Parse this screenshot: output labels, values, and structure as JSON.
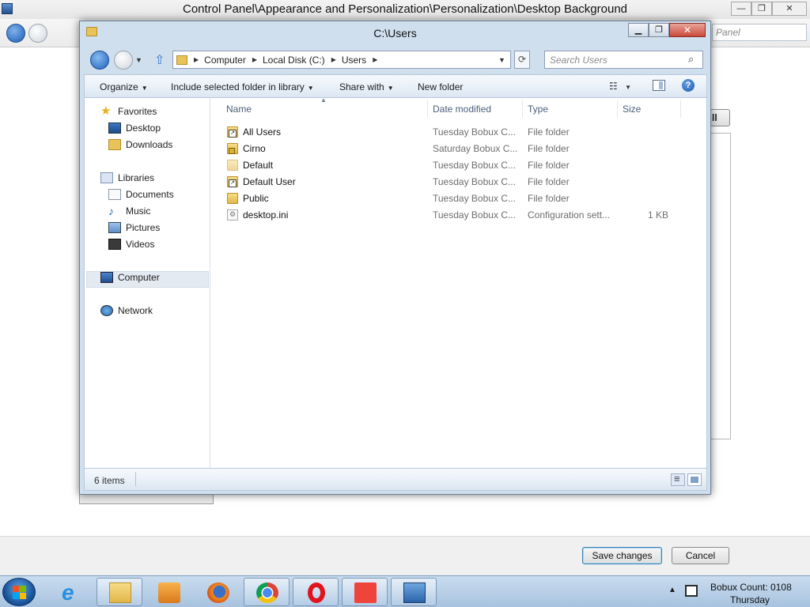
{
  "background_window": {
    "title": "Control Panel\\Appearance and Personalization\\Personalization\\Desktop Background",
    "search_placeholder": "Panel",
    "side_button_label": "ll",
    "save_label": "Save changes",
    "cancel_label": "Cancel",
    "controls": {
      "minimize": "—",
      "maximize": "❐",
      "close": "✕"
    }
  },
  "explorer": {
    "title": "C:\\Users",
    "controls": {
      "minimize": "▁",
      "maximize": "❐",
      "close": "✕"
    },
    "breadcrumb": [
      "Computer",
      "Local Disk (C:)",
      "Users"
    ],
    "search_placeholder": "Search Users",
    "toolbar": {
      "organize": "Organize",
      "include": "Include selected folder in library",
      "share": "Share with",
      "new_folder": "New folder"
    },
    "nav": {
      "favorites": "Favorites",
      "desktop": "Desktop",
      "downloads": "Downloads",
      "libraries": "Libraries",
      "documents": "Documents",
      "music": "Music",
      "pictures": "Pictures",
      "videos": "Videos",
      "computer": "Computer",
      "network": "Network"
    },
    "columns": {
      "name": "Name",
      "date": "Date modified",
      "type": "Type",
      "size": "Size"
    },
    "files": [
      {
        "name": "All Users",
        "date": "Tuesday Bobux C...",
        "type": "File folder",
        "size": ""
      },
      {
        "name": "Cirno",
        "date": "Saturday Bobux C...",
        "type": "File folder",
        "size": ""
      },
      {
        "name": "Default",
        "date": "Tuesday Bobux C...",
        "type": "File folder",
        "size": ""
      },
      {
        "name": "Default User",
        "date": "Tuesday Bobux C...",
        "type": "File folder",
        "size": ""
      },
      {
        "name": "Public",
        "date": "Tuesday Bobux C...",
        "type": "File folder",
        "size": ""
      },
      {
        "name": "desktop.ini",
        "date": "Tuesday Bobux C...",
        "type": "Configuration sett...",
        "size": "1 KB"
      }
    ],
    "status": {
      "count": "6 items"
    }
  },
  "taskbar": {
    "apps": [
      "internet-explorer",
      "windows-explorer",
      "media-player",
      "firefox",
      "chrome",
      "opera",
      "anydesk",
      "control-panel"
    ],
    "clock_line1": "Bobux Count: 0108",
    "clock_line2": "Thursday"
  },
  "colors": {
    "accent": "#3c7fb1",
    "taskbar": "#b8cfe6",
    "close": "#c74a3b"
  }
}
